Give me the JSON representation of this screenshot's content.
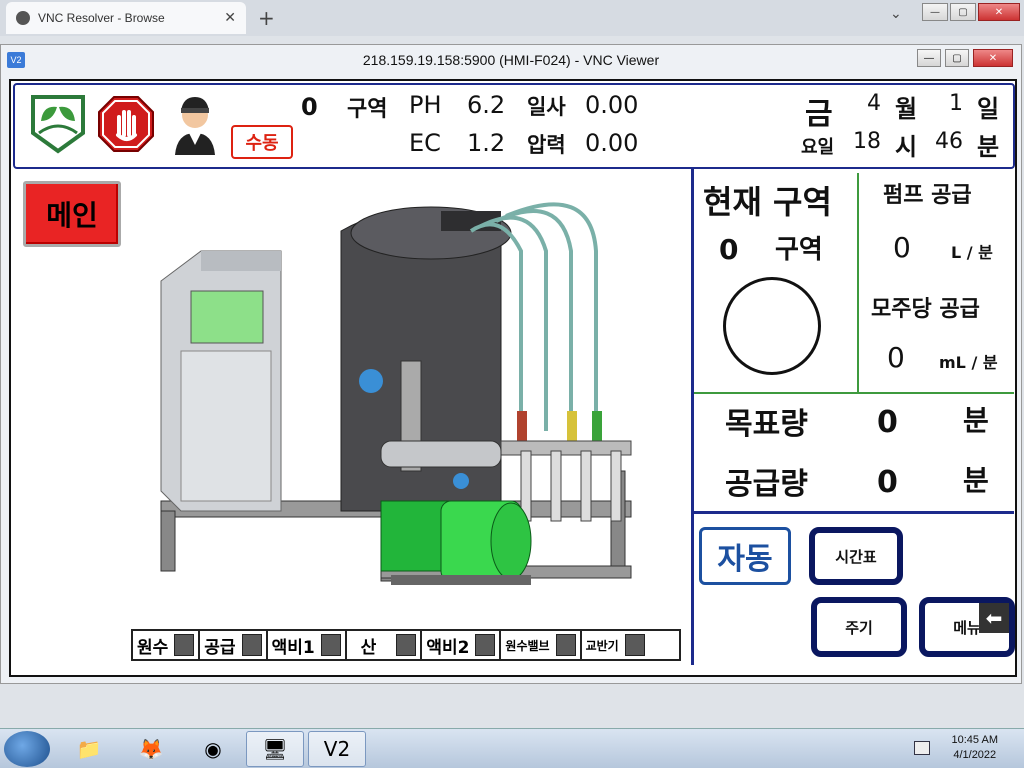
{
  "browser": {
    "tab_title": "VNC Resolver - Browse",
    "tab_close": "✕",
    "new_tab": "+",
    "chevron": "⌄",
    "win_min": "—",
    "win_max": "▢",
    "win_close": "✕"
  },
  "vnc": {
    "title": "218.159.19.158:5900 (HMI-F024) - VNC Viewer",
    "logo": "V2"
  },
  "header": {
    "zone_num": "0",
    "zone_label": "구역",
    "ph_label": "PH",
    "ph_value": "6.2",
    "ec_label": "EC",
    "ec_value": "1.2",
    "solar_label": "일사",
    "solar_value": "0.00",
    "pressure_label": "압력",
    "pressure_value": "0.00",
    "manual_badge": "수동",
    "weekday": "금",
    "weekday_label": "요일",
    "month_value": "4",
    "month_label": "월",
    "day_value": "1",
    "day_label": "일",
    "hour_value": "18",
    "hour_label": "시",
    "minute_value": "46",
    "minute_label": "분"
  },
  "main_button": "메인",
  "status_strip": [
    {
      "label": "원수"
    },
    {
      "label": "공급"
    },
    {
      "label": "액비1"
    },
    {
      "label": "산"
    },
    {
      "label": "액비2"
    },
    {
      "label": "원수밸브"
    },
    {
      "label": "교반기"
    }
  ],
  "right_panel": {
    "current_zone_title": "현재 구역",
    "current_zone_value": "0",
    "current_zone_unit": "구역",
    "pump_supply_title": "펌프 공급",
    "pump_supply_value": "0",
    "pump_supply_unit": "L / 분",
    "per_plant_title": "모주당 공급",
    "per_plant_value": "0",
    "per_plant_unit": "mL / 분",
    "target_label": "목표량",
    "target_value": "0",
    "target_unit": "분",
    "supplied_label": "공급량",
    "supplied_value": "0",
    "supplied_unit": "분",
    "auto_button": "자동",
    "schedule_button": "시간표",
    "cycle_button": "주기",
    "menu_button": "메뉴",
    "back_arrow": "⬅"
  },
  "taskbar": {
    "time": "10:45 AM",
    "date": "4/1/2022"
  }
}
